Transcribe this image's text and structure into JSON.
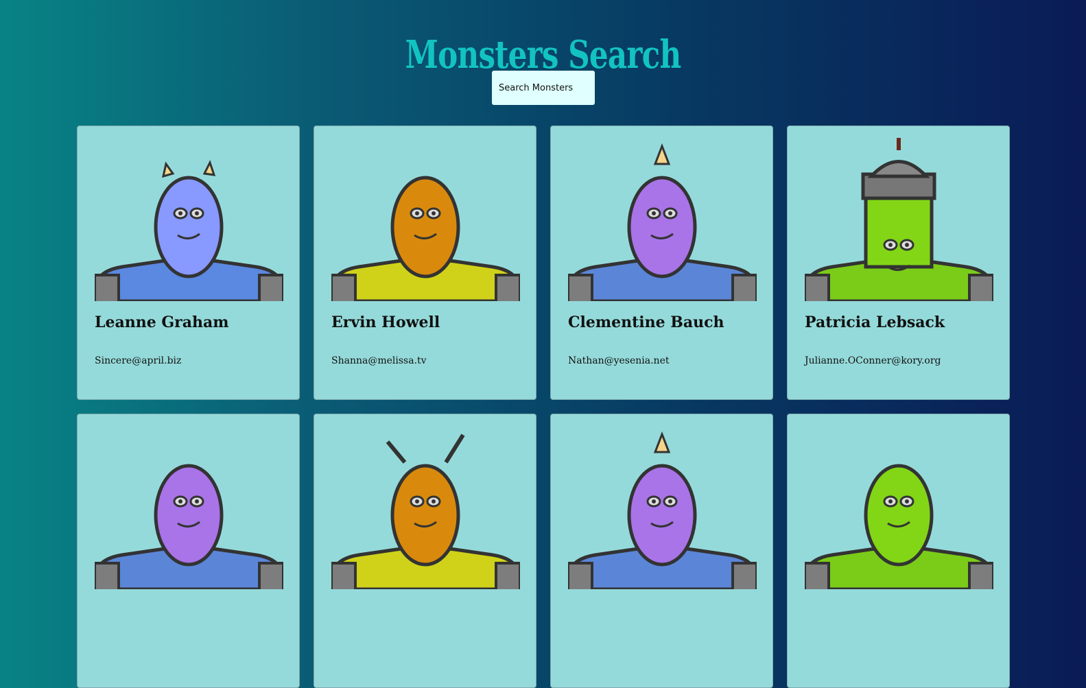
{
  "header": {
    "title": "Monsters Search"
  },
  "search": {
    "placeholder": "Search Monsters",
    "value": ""
  },
  "monsters": [
    {
      "name": "Leanne Graham",
      "email": "Sincere@april.biz",
      "skin": "#8899ff",
      "body": "#5b88e0",
      "icon": "horned-monster-icon"
    },
    {
      "name": "Ervin Howell",
      "email": "Shanna@melissa.tv",
      "skin": "#d98a0c",
      "body": "#cfd219",
      "icon": "spiky-monster-icon"
    },
    {
      "name": "Clementine Bauch",
      "email": "Nathan@yesenia.net",
      "skin": "#a874e8",
      "body": "#5b86d8",
      "icon": "cyclops-monster-icon"
    },
    {
      "name": "Patricia Lebsack",
      "email": "Julianne.OConner@kory.org",
      "skin": "#82d616",
      "body": "#7acc18",
      "icon": "helmet-monster-icon"
    },
    {
      "name": "",
      "email": "",
      "skin": "#a874e8",
      "body": "#5b86d8",
      "icon": "robot-monster-icon"
    },
    {
      "name": "",
      "email": "",
      "skin": "#d98a0c",
      "body": "#cfd219",
      "icon": "antenna-monster-icon"
    },
    {
      "name": "",
      "email": "",
      "skin": "#a874e8",
      "body": "#5b86d8",
      "icon": "horn-monster-icon"
    },
    {
      "name": "",
      "email": "",
      "skin": "#82d616",
      "body": "#7acc18",
      "icon": "robot-monster-icon"
    }
  ]
}
